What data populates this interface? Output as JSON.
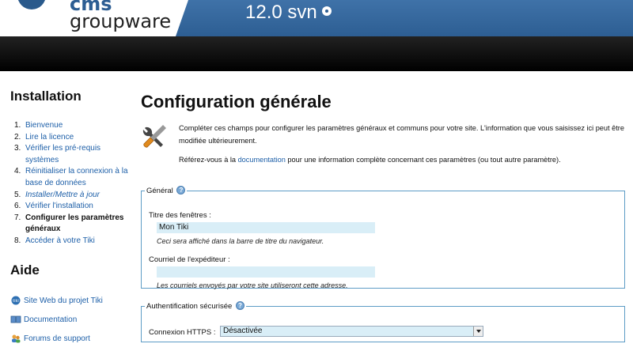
{
  "header": {
    "logo_line1": "cms",
    "logo_line2": "groupware",
    "version": "12.0 svn"
  },
  "sidebar": {
    "installation_heading": "Installation",
    "steps": [
      {
        "num": "1.",
        "label": "Bienvenue"
      },
      {
        "num": "2.",
        "label": "Lire la licence"
      },
      {
        "num": "3.",
        "label": "Vérifier les pré-requis systèmes"
      },
      {
        "num": "4.",
        "label": "Réinitialiser la connexion à la base de données"
      },
      {
        "num": "5.",
        "label": "Installer/Mettre à jour"
      },
      {
        "num": "6.",
        "label": "Vérifier l'installation"
      },
      {
        "num": "7.",
        "label": "Configurer les paramètres généraux"
      },
      {
        "num": "8.",
        "label": "Accéder à votre Tiki"
      }
    ],
    "help_heading": "Aide",
    "help_links": [
      {
        "label": "Site Web du projet Tiki",
        "icon": "tiki-logo-icon"
      },
      {
        "label": "Documentation",
        "icon": "book-icon"
      },
      {
        "label": "Forums de support",
        "icon": "users-icon"
      }
    ]
  },
  "main": {
    "title": "Configuration générale",
    "intro_1": "Compléter ces champs pour configurer les paramètres généraux et communs pour votre site. L'information que vous saisissez ici peut être modifiée ultérieurement.",
    "intro_2_pre": "Référez-vous à la ",
    "intro_2_link": "documentation",
    "intro_2_post": " pour une information complète concernant ces paramètres (ou tout autre paramètre).",
    "general": {
      "legend": "Général",
      "title_label": "Titre des fenêtres :",
      "title_value": "Mon Tiki",
      "title_help": "Ceci sera affiché dans la barre de titre du navigateur.",
      "email_label": "Courriel de l'expéditeur :",
      "email_value": "",
      "email_help": "Les courriels envoyés par votre site utiliseront cette adresse."
    },
    "secure": {
      "legend": "Authentification sécurisée",
      "https_label": "Connexion HTTPS :",
      "https_value": "Désactivée"
    }
  }
}
